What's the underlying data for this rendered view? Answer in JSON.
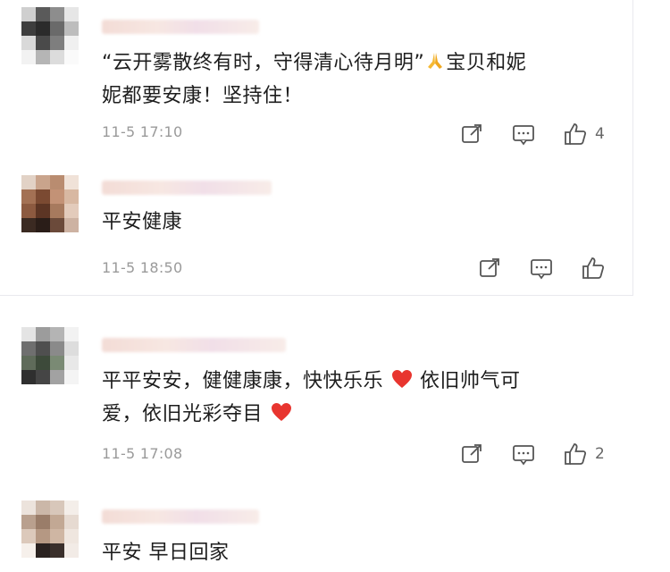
{
  "comments": [
    {
      "text_line1": "“云开雾散终有时，守得清心待月明”",
      "text_line1b": "宝贝和妮",
      "text_line2": "妮都要安康！坚持住！",
      "time": "11-5 17:10",
      "likes": "4"
    },
    {
      "text_line1": "平安健康",
      "time": "11-5 18:50",
      "likes": ""
    },
    {
      "text_line1": "平平安安，健健康康，快快乐乐",
      "text_line1b": "依旧帅气可",
      "text_line2": "爱，依旧光彩夺目",
      "time": "11-5 17:08",
      "likes": "2"
    },
    {
      "text_line1": "平安 早日回家"
    }
  ],
  "icons": {
    "share": "share-icon",
    "comment": "comment-icon",
    "like": "thumbs-up-icon",
    "pray": "praying-hands-icon",
    "heart": "red-heart-icon"
  },
  "colors": {
    "text": "#1e1e1e",
    "meta": "#9a9a9a",
    "icon": "#555555",
    "heart": "#e8352f",
    "pray": "#f5b935"
  }
}
